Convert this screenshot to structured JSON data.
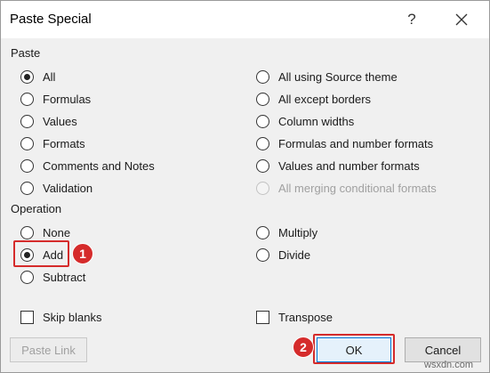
{
  "dialog": {
    "title": "Paste Special",
    "help_label": "?"
  },
  "paste": {
    "label": "Paste",
    "left": [
      {
        "label": "All",
        "checked": true
      },
      {
        "label": "Formulas"
      },
      {
        "label": "Values"
      },
      {
        "label": "Formats"
      },
      {
        "label": "Comments and Notes"
      },
      {
        "label": "Validation"
      }
    ],
    "right": [
      {
        "label": "All using Source theme"
      },
      {
        "label": "All except borders"
      },
      {
        "label": "Column widths"
      },
      {
        "label": "Formulas and number formats"
      },
      {
        "label": "Values and number formats"
      },
      {
        "label": "All merging conditional formats",
        "disabled": true
      }
    ]
  },
  "operation": {
    "label": "Operation",
    "left": [
      {
        "label": "None"
      },
      {
        "label": "Add",
        "checked": true
      },
      {
        "label": "Subtract"
      }
    ],
    "right": [
      {
        "label": "Multiply"
      },
      {
        "label": "Divide"
      }
    ]
  },
  "checks": {
    "skip_blanks": "Skip blanks",
    "transpose": "Transpose"
  },
  "buttons": {
    "paste_link": "Paste Link",
    "ok": "OK",
    "cancel": "Cancel"
  },
  "annotations": {
    "badge_1": "1",
    "badge_2": "2"
  },
  "watermark": "wsxdn.com",
  "colors": {
    "highlight": "#d52b2b",
    "ok_border": "#0078d7",
    "dialog_bg": "#f0f0f0"
  }
}
